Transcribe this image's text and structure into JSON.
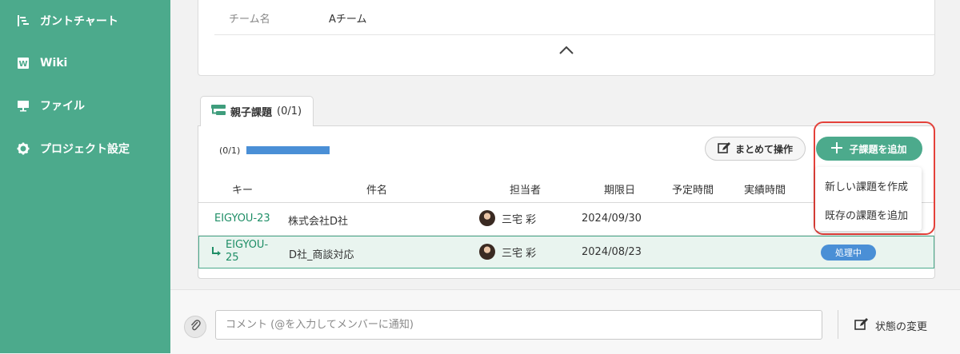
{
  "sidebar": {
    "items": [
      {
        "label": "ガントチャート",
        "icon": "gantt-chart-icon"
      },
      {
        "label": "Wiki",
        "icon": "wiki-icon"
      },
      {
        "label": "ファイル",
        "icon": "file-icon"
      },
      {
        "label": "プロジェクト設定",
        "icon": "gear-icon"
      }
    ]
  },
  "details": {
    "team_label": "チーム名",
    "team_value": "Aチーム"
  },
  "subtasks": {
    "tab_label": "親子課題",
    "tab_count": "(0/1)",
    "progress_text": "(0/1)",
    "progress_fraction": 1.0,
    "bulk_button": "まとめて操作",
    "add_button": "子課題を追加",
    "dropdown": [
      "新しい課題を作成",
      "既存の課題を追加"
    ],
    "columns": [
      "キー",
      "件名",
      "担当者",
      "期限日",
      "予定時間",
      "実績時間"
    ],
    "rows": [
      {
        "key": "EIGYOU-23",
        "subject": "株式会社D社",
        "assignee": "三宅 彩",
        "due": "2024/09/30",
        "status": ""
      },
      {
        "key_line1": "EIGYOU-",
        "key_line2": "25",
        "subject": "D社_商談対応",
        "assignee": "三宅 彩",
        "due": "2024/08/23",
        "status": "処理中"
      }
    ]
  },
  "comment": {
    "placeholder": "コメント (@を入力してメンバーに通知)",
    "status_change": "状態の変更"
  },
  "colors": {
    "brand_green": "#4caa8c",
    "status_blue": "#4a8fd6",
    "highlight_red": "#e4413a"
  }
}
